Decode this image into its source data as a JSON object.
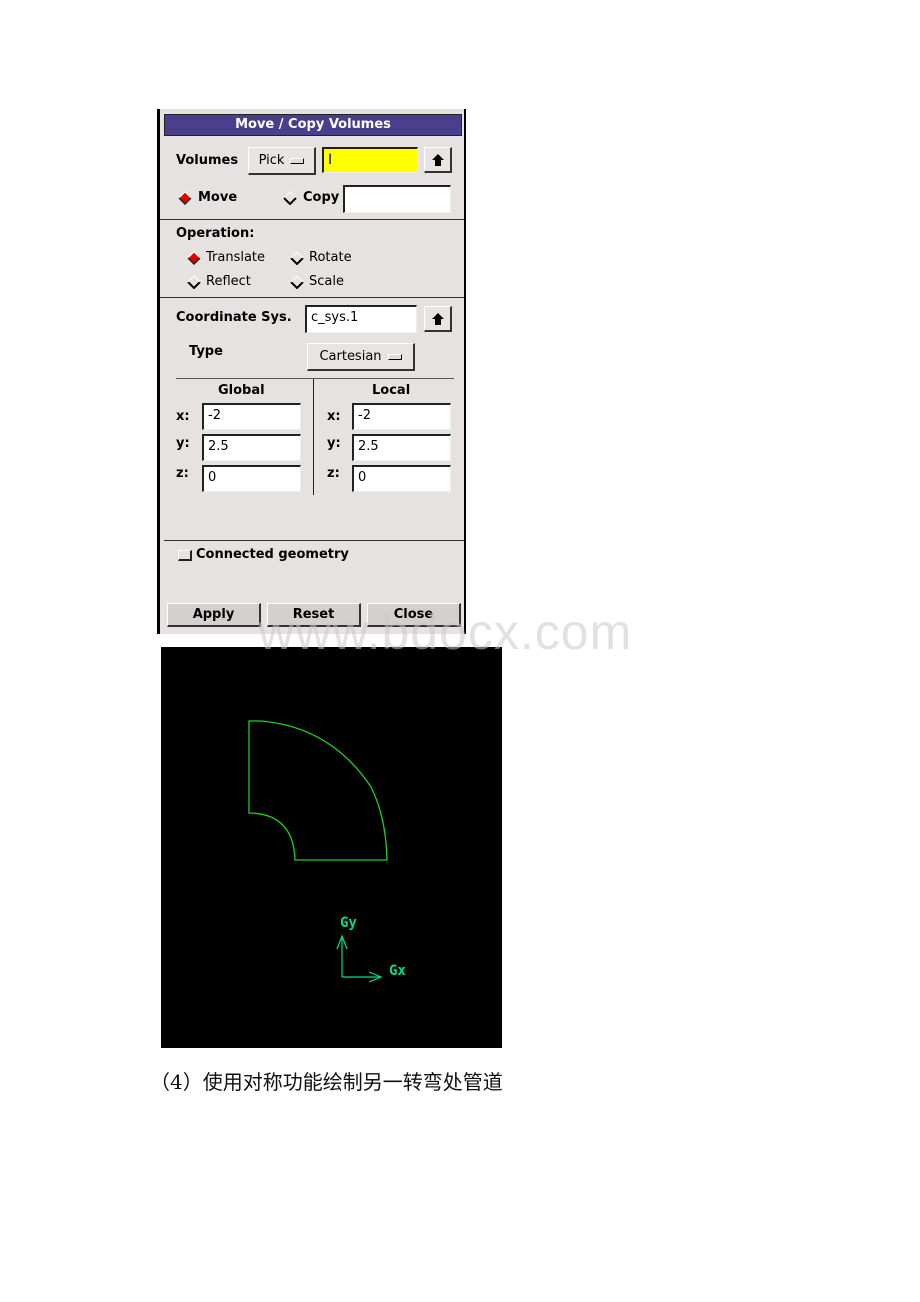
{
  "dialog": {
    "title": "Move / Copy Volumes",
    "volumes_label": "Volumes",
    "pick_label": "Pick",
    "volumes_value": "",
    "move_label": "Move",
    "copy_label": "Copy",
    "copy_value": "",
    "operation_label": "Operation:",
    "operations": [
      "Translate",
      "Rotate",
      "Reflect",
      "Scale"
    ],
    "selected_operation": "Translate",
    "selected_mode": "Move",
    "coord_sys_label": "Coordinate Sys.",
    "coord_sys_value": "c_sys.1",
    "type_label": "Type",
    "type_value": "Cartesian",
    "global_label": "Global",
    "local_label": "Local",
    "global": {
      "x": "-2",
      "y": "2.5",
      "z": "0"
    },
    "local": {
      "x": "-2",
      "y": "2.5",
      "z": "0"
    },
    "axis_labels": {
      "x": "x:",
      "y": "y:",
      "z": "z:"
    },
    "connected_geometry_label": "Connected geometry",
    "connected_geometry_checked": false,
    "apply_label": "Apply",
    "reset_label": "Reset",
    "close_label": "Close",
    "title_color": "#4a3f8c",
    "selected_radio_color": "#e00000"
  },
  "viewport": {
    "background": "#000000",
    "shape_color": "#22cc22",
    "axis_color": "#00dd88",
    "gy_label": "Gy",
    "gx_label": "Gx"
  },
  "watermark": "www.bdocx.com",
  "caption": "（4）使用对称功能绘制另一转弯处管道"
}
